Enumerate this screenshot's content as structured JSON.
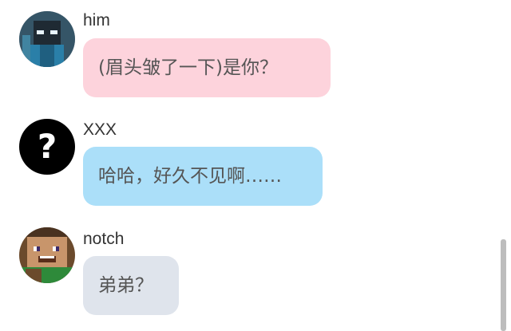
{
  "messages": [
    {
      "sender": "him",
      "text": "(眉头皱了一下)是你？",
      "bubble_color": "#fdd3dc",
      "avatar_icon": "herobrine-avatar-icon"
    },
    {
      "sender": "XXX",
      "text": "哈哈，好久不见啊……",
      "bubble_color": "#abdff9",
      "avatar_icon": "question-mark-avatar-icon"
    },
    {
      "sender": "notch",
      "text": "弟弟？",
      "bubble_color": "#dfe4ec",
      "avatar_icon": "notch-avatar-icon"
    }
  ]
}
